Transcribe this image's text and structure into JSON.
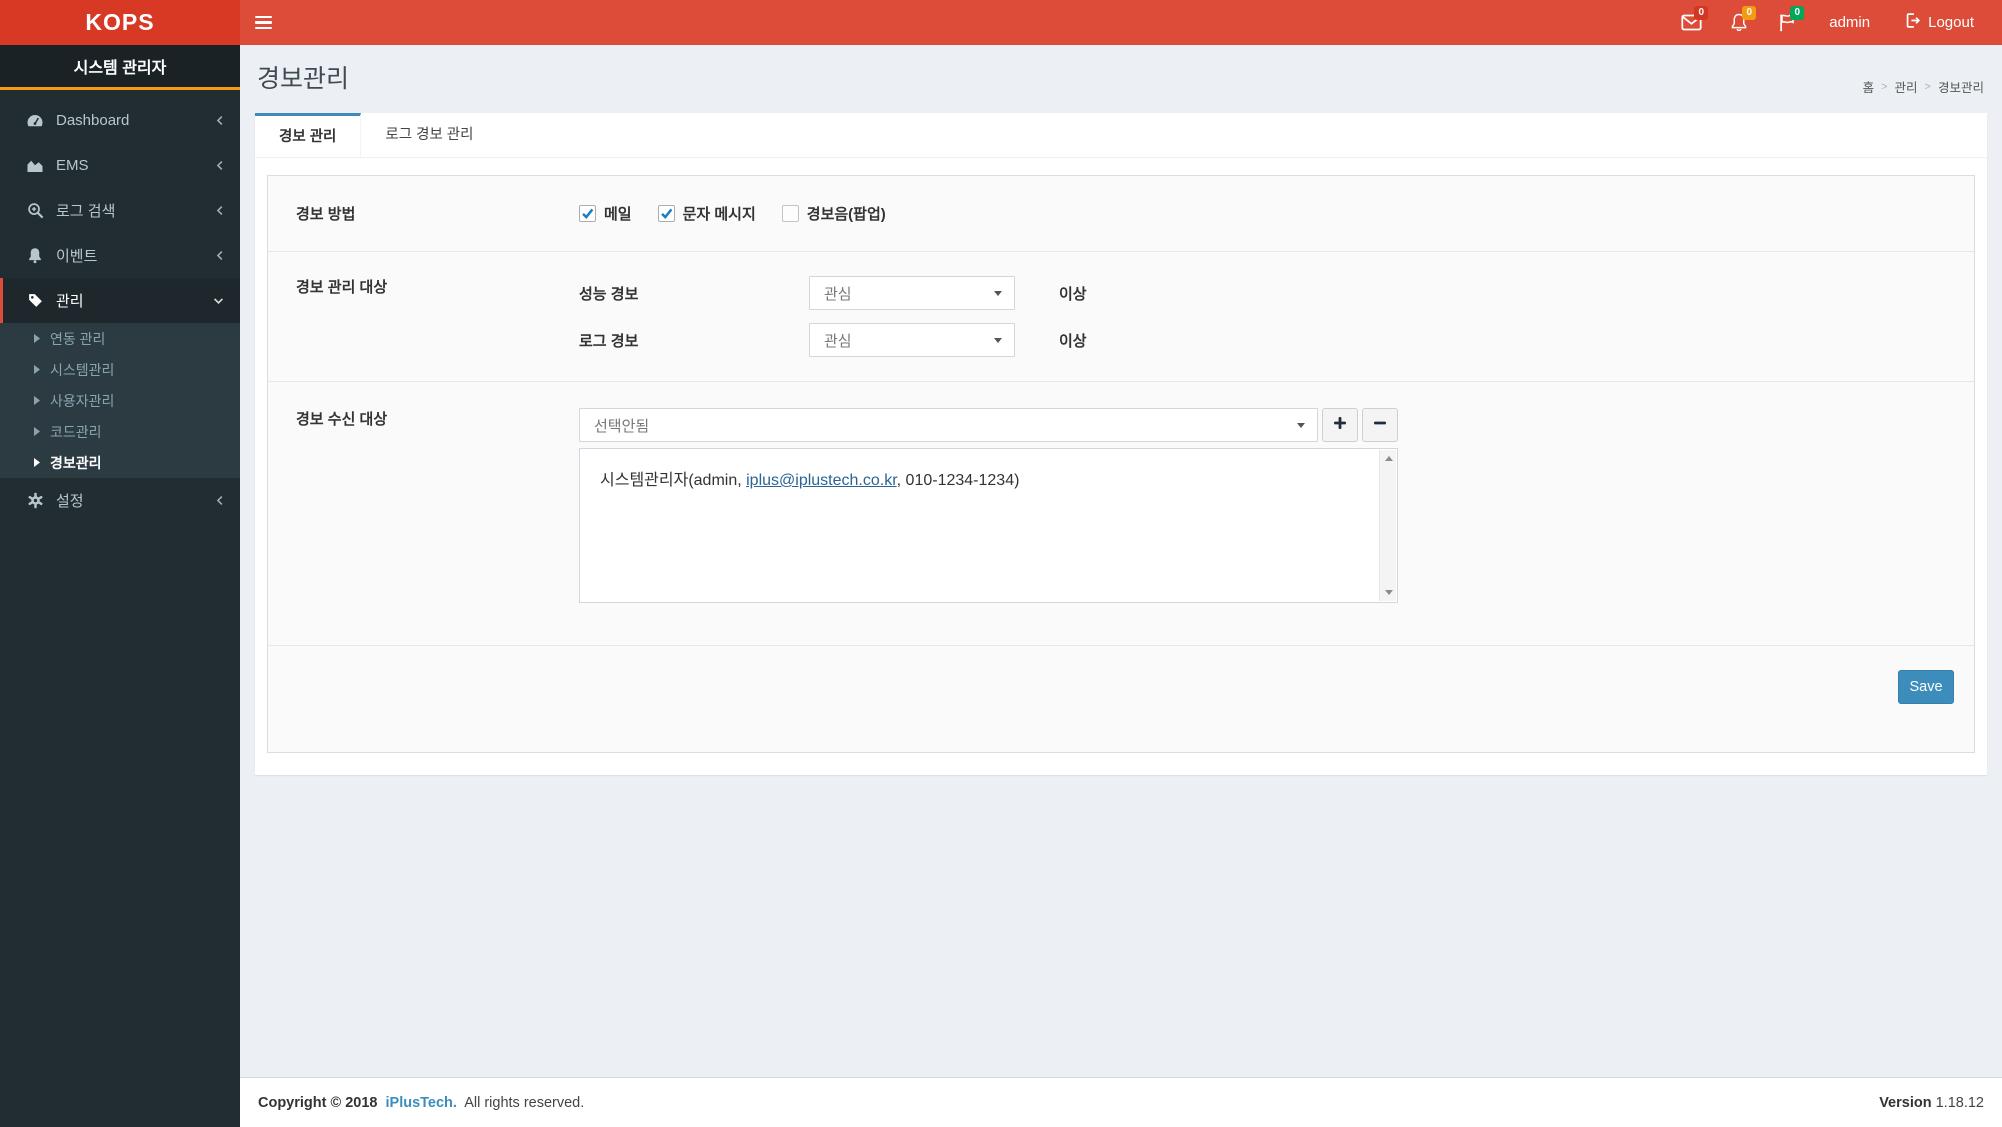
{
  "navbar": {
    "brand": "KOPS",
    "user": "admin",
    "logout_label": "Logout",
    "badges": {
      "messages": "0",
      "notifications": "0",
      "flags": "0"
    },
    "icons": [
      "hamburger-icon",
      "envelope-icon",
      "bell-icon",
      "flag-icon",
      "logout-icon"
    ]
  },
  "sidebar": {
    "role_title": "시스템 관리자",
    "items": [
      {
        "label": "Dashboard",
        "icon": "dashboard-icon",
        "active": false
      },
      {
        "label": "EMS",
        "icon": "area-chart-icon",
        "active": false
      },
      {
        "label": "로그 검색",
        "icon": "search-plus-icon",
        "active": false
      },
      {
        "label": "이벤트",
        "icon": "bell-icon",
        "active": false
      },
      {
        "label": "관리",
        "icon": "tag-icon",
        "active": true,
        "expanded": true,
        "children": [
          {
            "label": "연동 관리",
            "active": false
          },
          {
            "label": "시스템관리",
            "active": false
          },
          {
            "label": "사용자관리",
            "active": false
          },
          {
            "label": "코드관리",
            "active": false
          },
          {
            "label": "경보관리",
            "active": true
          }
        ]
      },
      {
        "label": "설정",
        "icon": "gear-icon",
        "active": false
      }
    ]
  },
  "content": {
    "page_title": "경보관리",
    "breadcrumb": {
      "home": "홈",
      "section": "관리",
      "current": "경보관리",
      "separator": ">"
    },
    "tabs": [
      {
        "label": "경보 관리",
        "active": true
      },
      {
        "label": "로그 경보 관리",
        "active": false
      }
    ],
    "form": {
      "alert_method": {
        "label": "경보 방법",
        "options": [
          {
            "label": "메일",
            "checked": true
          },
          {
            "label": "문자 메시지",
            "checked": true
          },
          {
            "label": "경보음(팝업)",
            "checked": false
          }
        ]
      },
      "alert_level": {
        "label": "경보 관리 대상",
        "rows": [
          {
            "label": "성능 경보",
            "selected": "관심",
            "suffix": "이상"
          },
          {
            "label": "로그 경보",
            "selected": "관심",
            "suffix": "이상"
          }
        ]
      },
      "alert_receiver": {
        "label": "경보 수신 대상",
        "selected": "선택안됨",
        "entry": {
          "text_before": "시스템관리자(admin, ",
          "email": "iplus@iplustech.co.kr",
          "text_after": ",  010-1234-1234)"
        }
      },
      "save_label": "Save"
    }
  },
  "footer": {
    "copyright_bold": "Copyright © 2018",
    "company_link": "iPlusTech.",
    "rights": "All rights reserved.",
    "version_label": "Version",
    "version_value": "1.18.12"
  },
  "colors": {
    "navbar_red": "#dd4b39",
    "logo_red": "#d73925",
    "accent_blue": "#3c8dbc",
    "badge_danger": "#d33724",
    "badge_warning": "#f39c12",
    "badge_success": "#00a65a",
    "sidebar_dark": "#222d32",
    "submenu_dark": "#2c3b41",
    "orange_divider": "#f39c12"
  }
}
